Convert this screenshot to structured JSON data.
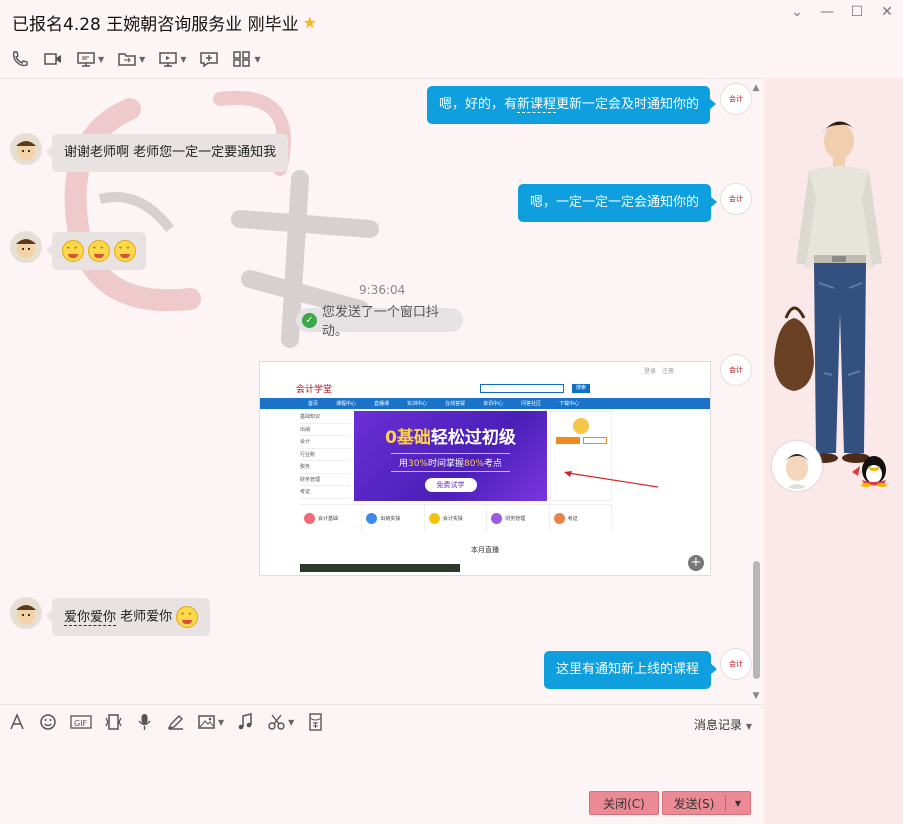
{
  "window": {
    "title": "已报名4.28 王婉朝咨询服务业  刚毕业",
    "controls": [
      "chevron-down",
      "minimize",
      "maximize",
      "close"
    ]
  },
  "toolbar": {
    "icons": [
      "phone-icon",
      "video-icon",
      "screen-share-icon",
      "file-transfer-icon",
      "remote-desktop-icon",
      "add-chat-icon",
      "apps-icon"
    ]
  },
  "messages": [
    {
      "side": "out",
      "text_a": "嗯，好的，有",
      "text_ul": "新课程",
      "text_b": "更新一定会及时通知你的"
    },
    {
      "side": "in",
      "text": "谢谢老师啊  老师您一定一定要通知我"
    },
    {
      "side": "out",
      "text": "嗯，一定一定一定会通知你的"
    },
    {
      "side": "in",
      "emoji_count": 3
    },
    {
      "side": "time",
      "text": "9:36:04"
    },
    {
      "side": "system",
      "text": "您发送了一个窗口抖动。"
    },
    {
      "side": "out",
      "type": "image"
    },
    {
      "side": "in",
      "text_ul": "爱你爱你",
      "text_b": " 老师爱你"
    },
    {
      "side": "out",
      "text": "这里有通知新上线的课程"
    }
  ],
  "screenshot": {
    "top_links": [
      "登录",
      "注册"
    ],
    "logo": "会计学堂",
    "search_btn": "搜索",
    "nav": [
      "首页",
      "课程中心",
      "直播课",
      "实训中心",
      "在线答疑",
      "资讯中心",
      "问答社区",
      "下载中心"
    ],
    "left_menu": [
      "基础知识",
      "出纳",
      "会计",
      "行业账",
      "税务",
      "财务管理",
      "考证"
    ],
    "banner": {
      "title_a": "0基础",
      "title_b": "轻松过初级",
      "sub_a": "用",
      "sub_hl1": "30%",
      "sub_b": "时间掌握",
      "sub_hl2": "80%",
      "sub_c": "考点",
      "button": "免费试学"
    },
    "cards": [
      "会计基础",
      "出纳实操",
      "会计实操",
      "财务管理",
      "考证"
    ],
    "section_title": "本月直播"
  },
  "input": {
    "toolbar_icons": [
      "font-icon",
      "emoji-icon",
      "gif-icon",
      "shake-icon",
      "voice-icon",
      "handwrite-icon",
      "image-icon",
      "music-icon",
      "screenshot-icon",
      "red-packet-icon"
    ],
    "history_label": "消息记录"
  },
  "buttons": {
    "close": "关闭(C)",
    "send": "发送(S)"
  },
  "colors": {
    "bubble_out": "#0f9ede",
    "bubble_in": "#e8e2e3",
    "button_pink": "#eb8a95"
  }
}
